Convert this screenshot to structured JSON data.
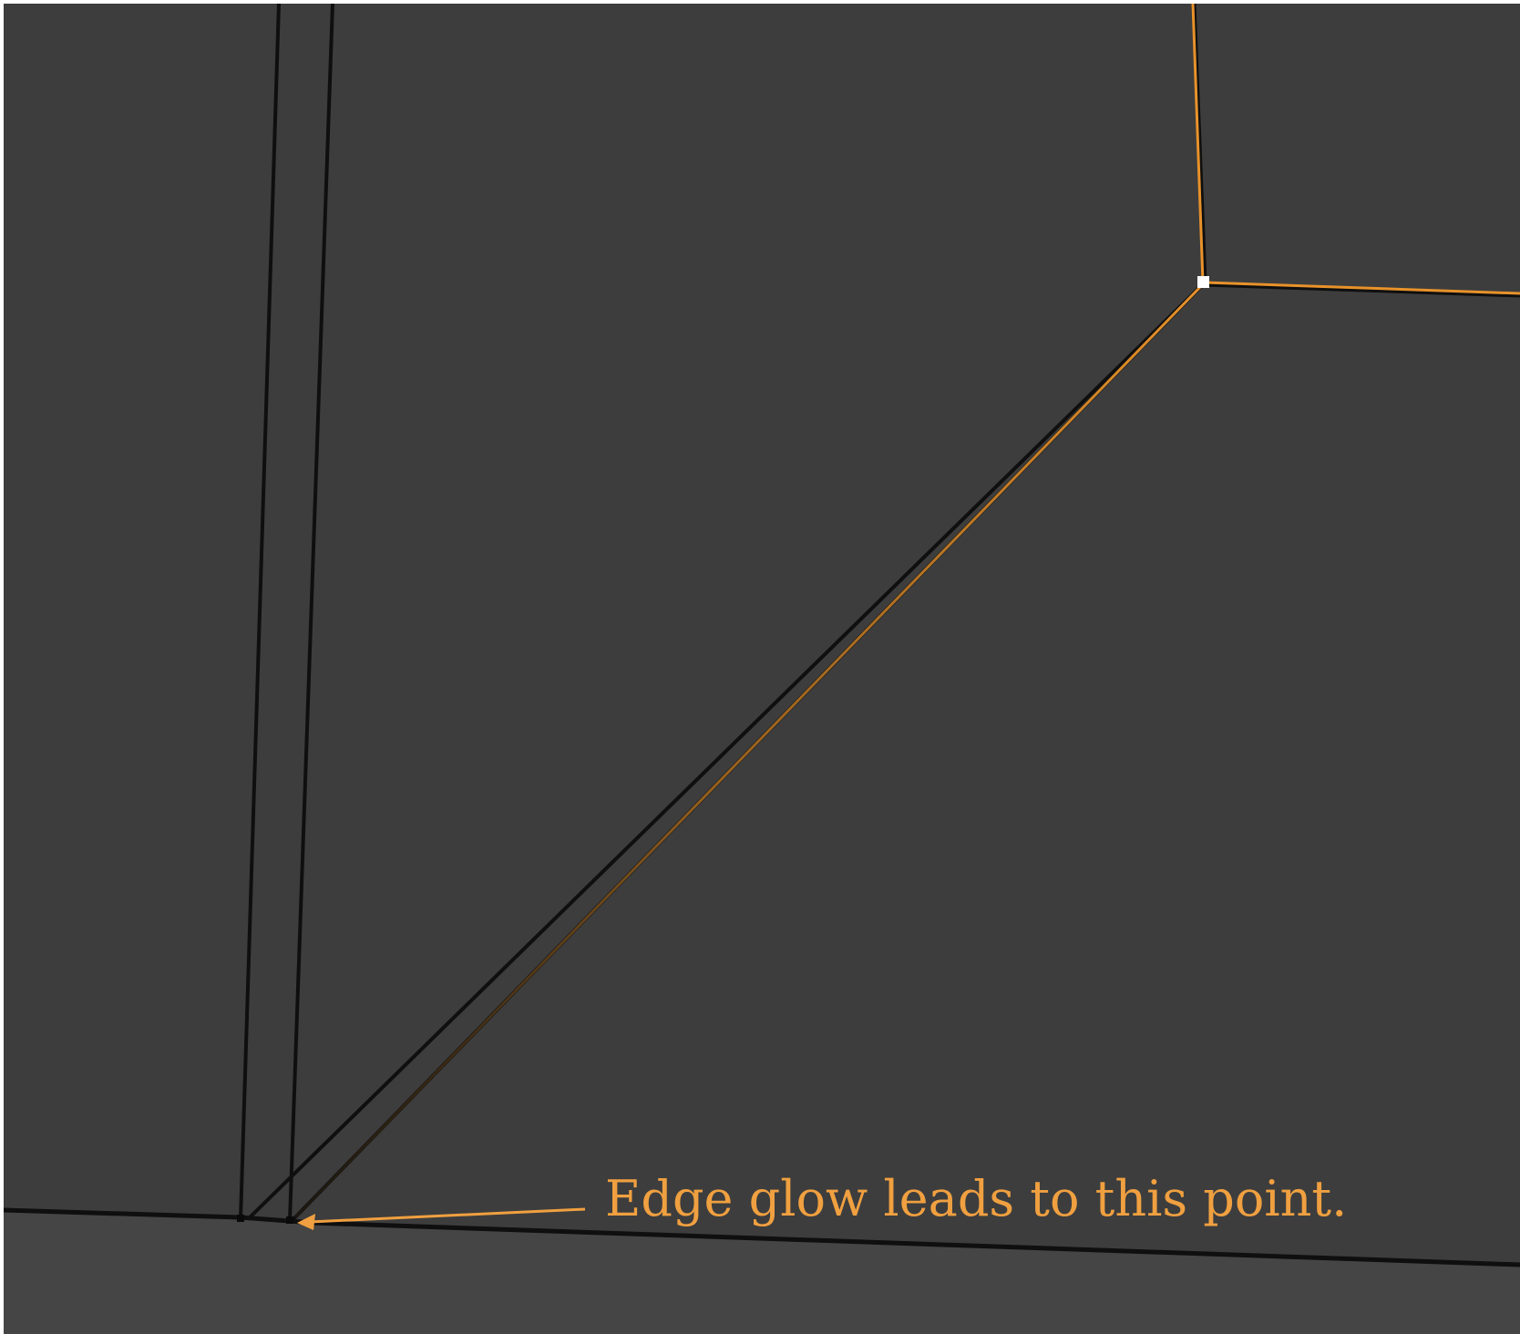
{
  "annotation": {
    "text": "Edge glow leads to this point.",
    "color": "#f0a040"
  },
  "colors": {
    "background": "#3d3d3d",
    "lower_face": "#454545",
    "edge": "#0f0f0f",
    "selected_edge": "#e8922a",
    "selected_vertex": "#ffffff"
  }
}
